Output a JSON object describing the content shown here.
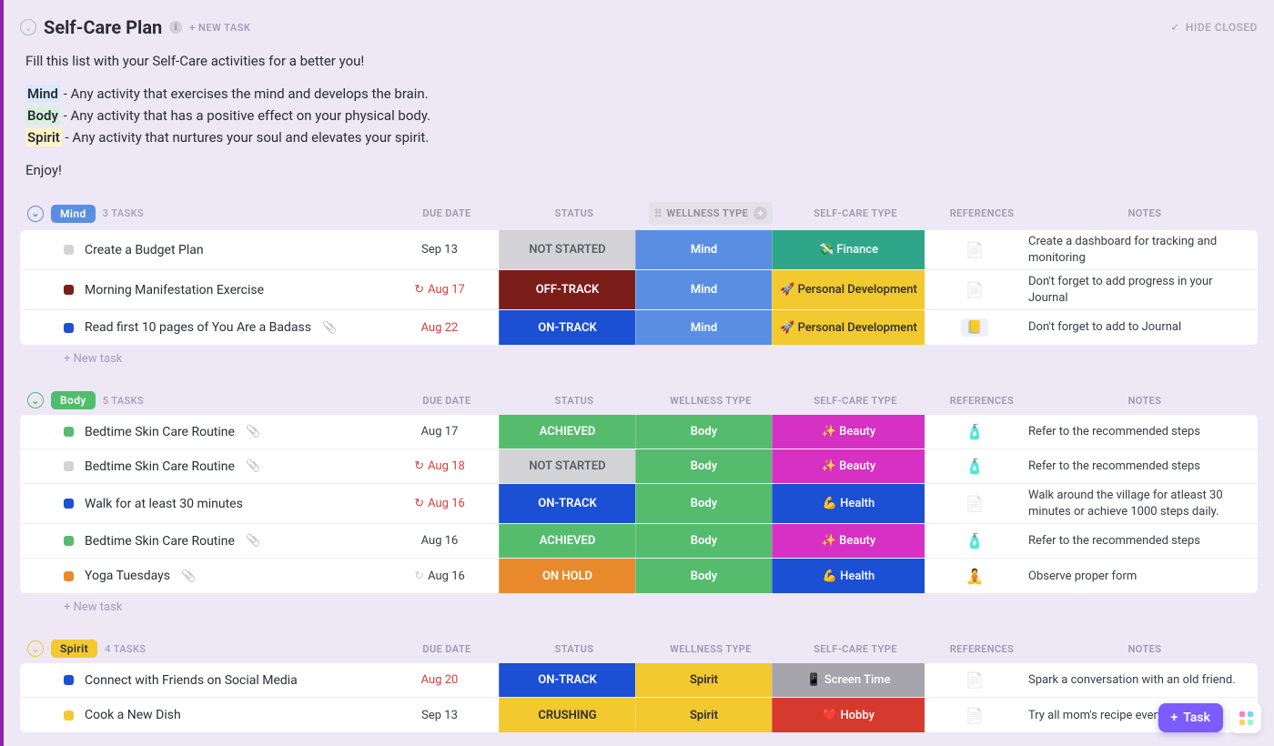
{
  "header": {
    "title": "Self-Care Plan",
    "new_task": "+ NEW TASK",
    "hide_closed": "HIDE CLOSED"
  },
  "intro": {
    "line1": "Fill this list with your Self-Care activities for a better you!",
    "mind_label": "Mind",
    "mind_desc": " - Any activity that exercises the mind and develops the brain.",
    "body_label": "Body",
    "body_desc": " - Any activity that has a positive effect on your physical body.",
    "spirit_label": "Spirit",
    "spirit_desc": " - Any activity that nurtures your soul and elevates your spirit.",
    "enjoy": "Enjoy!"
  },
  "columns": {
    "due": "DUE DATE",
    "status": "STATUS",
    "wellness": "WELLNESS TYPE",
    "care": "SELF-CARE TYPE",
    "references": "REFERENCES",
    "notes": "NOTES"
  },
  "new_task_row": "+ New task",
  "colors": {
    "mind": "#5a8ee2",
    "body": "#4ebd6c",
    "spirit": "#f2c92f",
    "status_not_started_bg": "#d3d2d6",
    "status_not_started_fg": "#5b5e68",
    "status_offtrack": "#7b1d18",
    "status_ontrack": "#1b4fd4",
    "status_achieved": "#55bc6e",
    "status_onhold": "#e88a2c",
    "status_crushing_bg": "#f2c92f",
    "status_crushing_fg": "#2b2d35",
    "wellness_mind": "#5a8ee2",
    "wellness_body": "#55bc6e",
    "wellness_spirit_bg": "#f2c92f",
    "wellness_spirit_fg": "#2b2d35",
    "care_finance": "#2fa68a",
    "care_personal_bg": "#f2c92f",
    "care_personal_fg": "#2b2d35",
    "care_beauty": "#d631c4",
    "care_health": "#1b4fd4",
    "care_screen": "#a6a4ad",
    "care_hobby": "#d63a2e"
  },
  "groups": [
    {
      "id": "mind",
      "label": "Mind",
      "count": "3 TASKS",
      "pill_color": "#5a8ee2",
      "collapse_color": "#5a8ee2",
      "show_wellness_head_decor": true,
      "rows": [
        {
          "square": "#d3d2d6",
          "name": "Create a Budget Plan",
          "attach": false,
          "recur": false,
          "due": "Sep 13",
          "due_red": false,
          "status": "NOT STARTED",
          "status_bg": "#d3d2d6",
          "status_fg": "#5b5e68",
          "wellness": "Mind",
          "wellness_bg": "#5a8ee2",
          "care": "💸 Finance",
          "care_bg": "#2fa68a",
          "care_fg": "#ffffff",
          "ref": "📄",
          "ref_chip": false,
          "notes": "Create a dashboard for tracking and monitoring"
        },
        {
          "square": "#7b1d18",
          "name": "Morning Manifestation Exercise",
          "attach": false,
          "recur": true,
          "due": "Aug 17",
          "due_red": true,
          "status": "OFF-TRACK",
          "status_bg": "#7b1d18",
          "status_fg": "#ffffff",
          "wellness": "Mind",
          "wellness_bg": "#5a8ee2",
          "care": "🚀 Personal Development",
          "care_bg": "#f2c92f",
          "care_fg": "#2b2d35",
          "ref": "📄",
          "ref_chip": false,
          "notes": "Don't forget to add progress in your Journal"
        },
        {
          "square": "#1b4fd4",
          "name": "Read first 10 pages of You Are a Badass",
          "attach": true,
          "recur": false,
          "due": "Aug 22",
          "due_red": true,
          "status": "ON-TRACK",
          "status_bg": "#1b4fd4",
          "status_fg": "#ffffff",
          "wellness": "Mind",
          "wellness_bg": "#5a8ee2",
          "care": "🚀 Personal Development",
          "care_bg": "#f2c92f",
          "care_fg": "#2b2d35",
          "ref": "📒",
          "ref_chip": true,
          "notes": "Don't forget to add to Journal"
        }
      ]
    },
    {
      "id": "body",
      "label": "Body",
      "count": "5 TASKS",
      "pill_color": "#4ebd6c",
      "collapse_color": "#4ebd6c",
      "show_wellness_head_decor": false,
      "rows": [
        {
          "square": "#55bc6e",
          "name": "Bedtime Skin Care Routine",
          "attach": true,
          "recur": false,
          "due": "Aug 17",
          "due_red": false,
          "status": "ACHIEVED",
          "status_bg": "#55bc6e",
          "status_fg": "#ffffff",
          "wellness": "Body",
          "wellness_bg": "#55bc6e",
          "care": "✨ Beauty",
          "care_bg": "#d631c4",
          "care_fg": "#ffffff",
          "ref": "🧴",
          "ref_chip": false,
          "notes": "Refer to the recommended steps"
        },
        {
          "square": "#d3d2d6",
          "name": "Bedtime Skin Care Routine",
          "attach": true,
          "recur": true,
          "due": "Aug 18",
          "due_red": true,
          "status": "NOT STARTED",
          "status_bg": "#d3d2d6",
          "status_fg": "#5b5e68",
          "wellness": "Body",
          "wellness_bg": "#55bc6e",
          "care": "✨ Beauty",
          "care_bg": "#d631c4",
          "care_fg": "#ffffff",
          "ref": "🧴",
          "ref_chip": false,
          "notes": "Refer to the recommended steps"
        },
        {
          "square": "#1b4fd4",
          "name": "Walk for at least 30 minutes",
          "attach": false,
          "recur": true,
          "due": "Aug 16",
          "due_red": true,
          "status": "ON-TRACK",
          "status_bg": "#1b4fd4",
          "status_fg": "#ffffff",
          "wellness": "Body",
          "wellness_bg": "#55bc6e",
          "care": "💪 Health",
          "care_bg": "#1b4fd4",
          "care_fg": "#ffffff",
          "ref": "📄",
          "ref_chip": false,
          "notes": "Walk around the village for atleast 30 minutes or achieve 1000 steps daily."
        },
        {
          "square": "#55bc6e",
          "name": "Bedtime Skin Care Routine",
          "attach": true,
          "recur": false,
          "due": "Aug 16",
          "due_red": false,
          "status": "ACHIEVED",
          "status_bg": "#55bc6e",
          "status_fg": "#ffffff",
          "wellness": "Body",
          "wellness_bg": "#55bc6e",
          "care": "✨ Beauty",
          "care_bg": "#d631c4",
          "care_fg": "#ffffff",
          "ref": "🧴",
          "ref_chip": false,
          "notes": "Refer to the recommended steps"
        },
        {
          "square": "#e88a2c",
          "name": "Yoga Tuesdays",
          "attach": true,
          "recur": true,
          "due": "Aug 16",
          "due_red": false,
          "status": "ON HOLD",
          "status_bg": "#e88a2c",
          "status_fg": "#ffffff",
          "wellness": "Body",
          "wellness_bg": "#55bc6e",
          "care": "💪 Health",
          "care_bg": "#1b4fd4",
          "care_fg": "#ffffff",
          "ref": "🧘",
          "ref_chip": false,
          "notes": "Observe proper form"
        }
      ]
    },
    {
      "id": "spirit",
      "label": "Spirit",
      "count": "4 TASKS",
      "pill_color": "#f2c92f",
      "collapse_color": "#f2c92f",
      "show_wellness_head_decor": false,
      "rows": [
        {
          "square": "#1b4fd4",
          "name": "Connect with Friends on Social Media",
          "attach": false,
          "recur": false,
          "due": "Aug 20",
          "due_red": true,
          "status": "ON-TRACK",
          "status_bg": "#1b4fd4",
          "status_fg": "#ffffff",
          "wellness": "Spirit",
          "wellness_bg": "#f2c92f",
          "wellness_fg": "#2b2d35",
          "care": "📱 Screen Time",
          "care_bg": "#a6a4ad",
          "care_fg": "#ffffff",
          "ref": "📄",
          "ref_chip": false,
          "notes": "Spark a conversation with an old friend."
        },
        {
          "square": "#f2c92f",
          "name": "Cook a New Dish",
          "attach": false,
          "recur": false,
          "due": "Sep 13",
          "due_red": false,
          "status": "CRUSHING",
          "status_bg": "#f2c92f",
          "status_fg": "#2b2d35",
          "wellness": "Spirit",
          "wellness_bg": "#f2c92f",
          "wellness_fg": "#2b2d35",
          "care": "❤️ Hobby",
          "care_bg": "#d63a2e",
          "care_fg": "#ffffff",
          "ref": "📄",
          "ref_chip": false,
          "notes": "Try all mom's recipe every weekend"
        }
      ]
    }
  ],
  "fab": {
    "task": "Task"
  }
}
